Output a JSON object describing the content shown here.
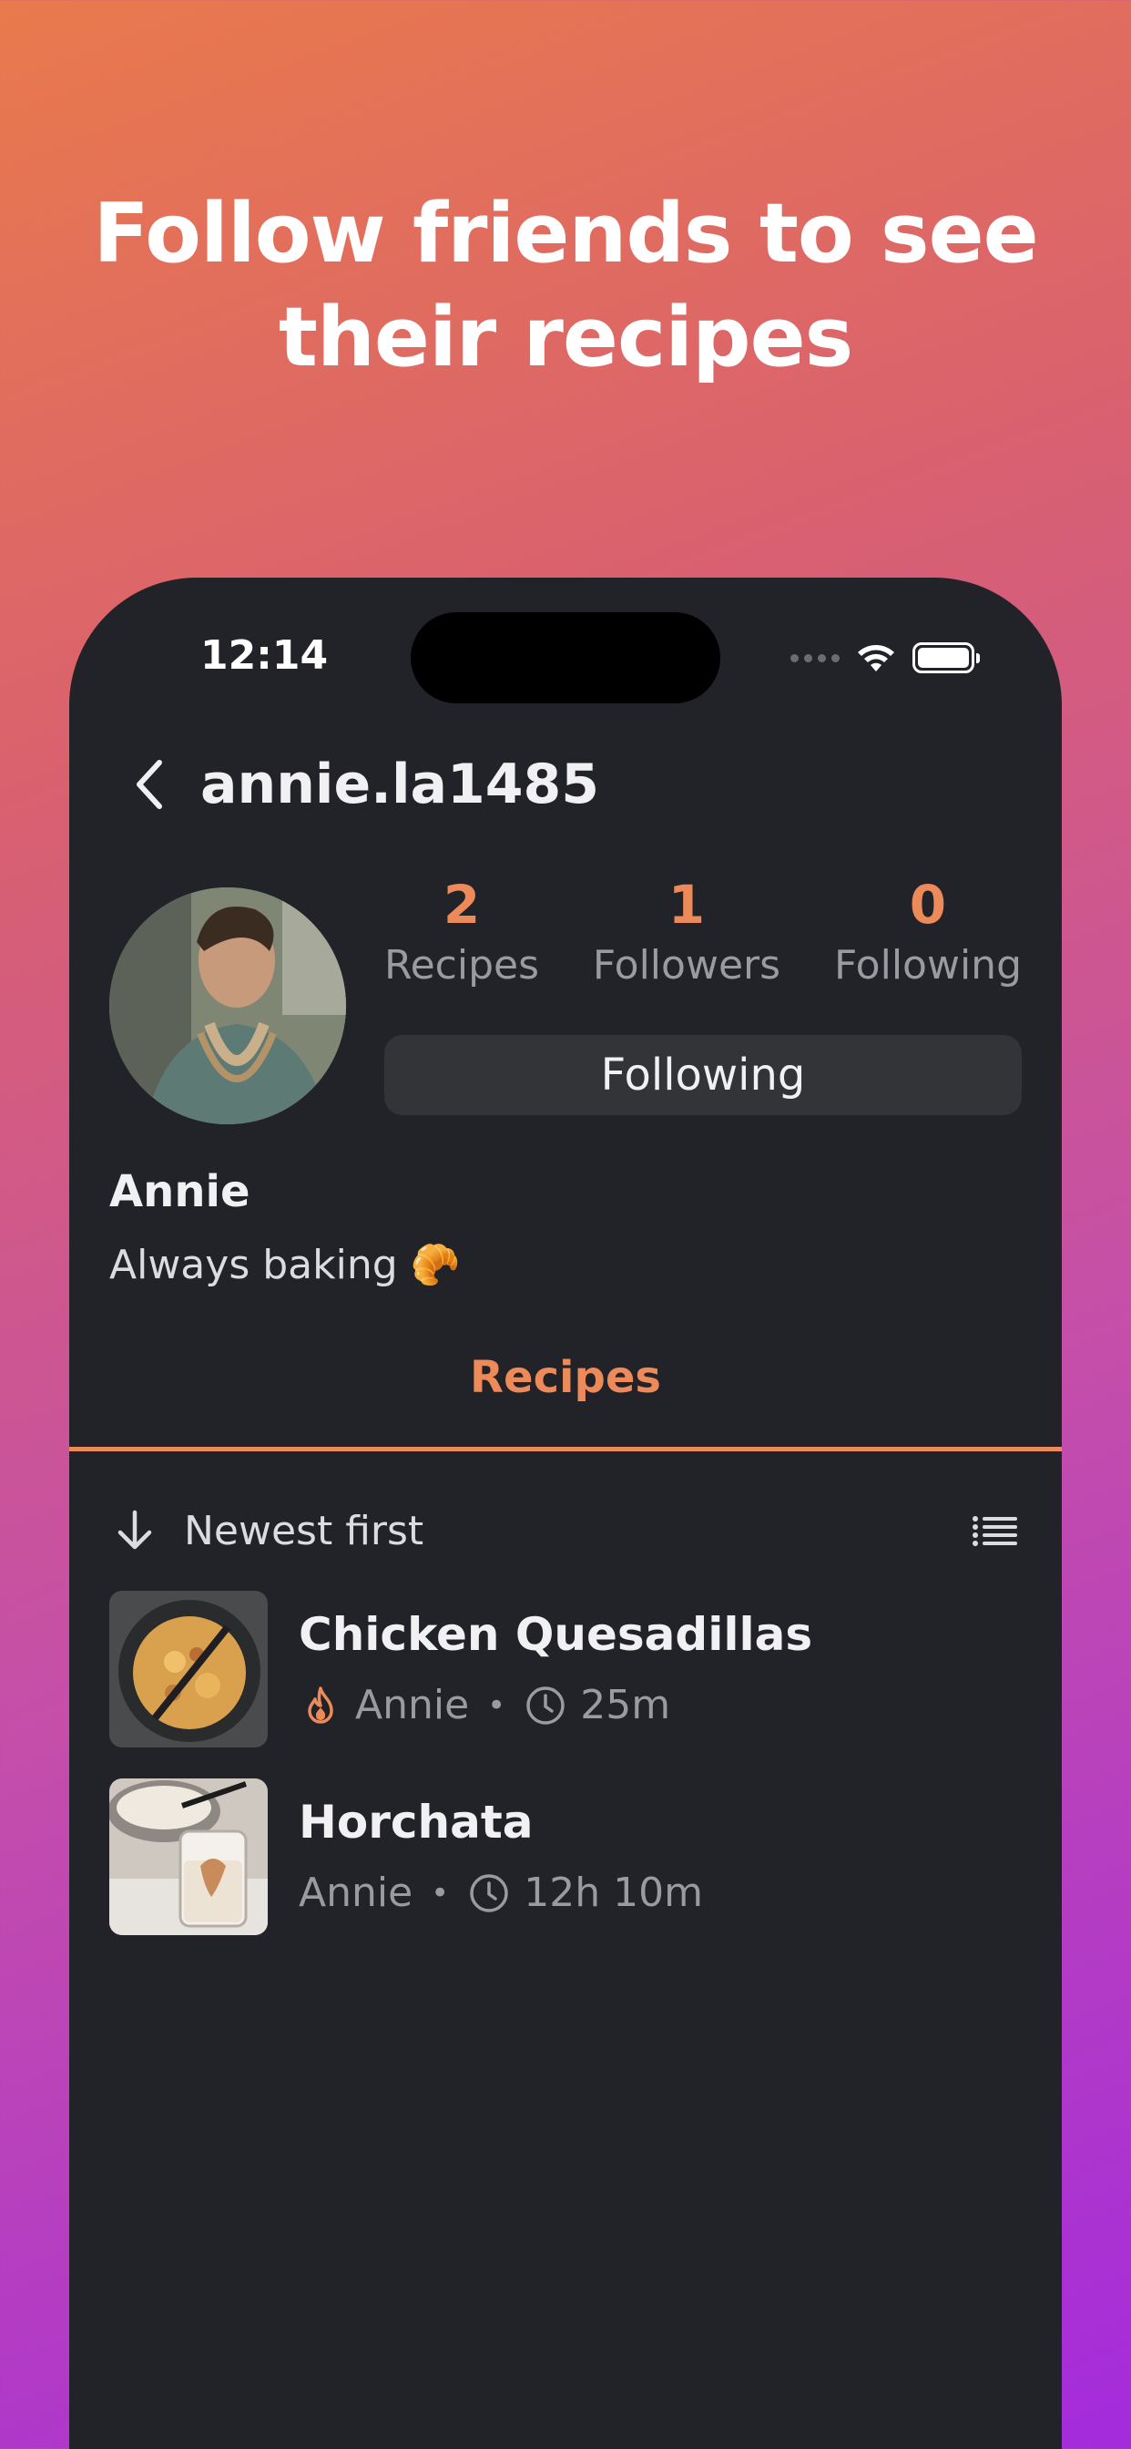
{
  "promo": {
    "headline_line1": "Follow friends to see",
    "headline_line2": "their recipes"
  },
  "status_bar": {
    "time": "12:14"
  },
  "nav": {
    "title": "annie.la1485"
  },
  "profile": {
    "stats": [
      {
        "value": "2",
        "label": "Recipes"
      },
      {
        "value": "1",
        "label": "Followers"
      },
      {
        "value": "0",
        "label": "Following"
      }
    ],
    "follow_button": "Following",
    "name": "Annie",
    "bio": "Always baking 🥐"
  },
  "tabs": {
    "active": "Recipes"
  },
  "sort": {
    "label": "Newest first"
  },
  "recipes": [
    {
      "title": "Chicken Quesadillas",
      "author": "Annie",
      "time": "25m",
      "hot": true
    },
    {
      "title": "Horchata",
      "author": "Annie",
      "time": "12h 10m",
      "hot": false
    }
  ],
  "colors": {
    "accent": "#ec8a5a",
    "background": "#222329",
    "muted": "#9a9ba2"
  },
  "icons": [
    "back-chevron-icon",
    "wifi-icon",
    "battery-icon",
    "arrow-down-icon",
    "list-icon",
    "flame-icon",
    "clock-icon"
  ]
}
